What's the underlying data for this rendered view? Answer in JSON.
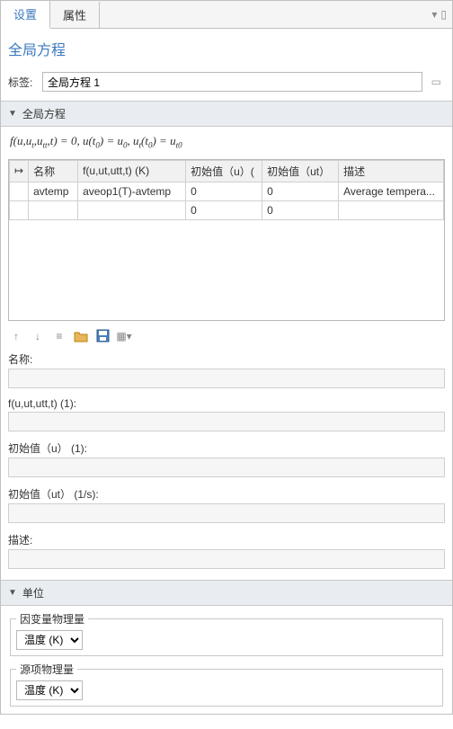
{
  "tabs": {
    "settings": "设置",
    "properties": "属性"
  },
  "title": "全局方程",
  "tag_label": "标签:",
  "tag_value": "全局方程 1",
  "section_global": "全局方程",
  "formula_html": "f(u,u<span class='sub'>t</span>,u<span class='sub'>tt</span>,t) = 0,  u(t<span class='sub'>0</span>) = u<span class='sub'>0</span>,  u<span class='sub'>t</span>(t<span class='sub'>0</span>) = u<span class='sub'>t0</span>",
  "table": {
    "headers": {
      "arrow": "↦",
      "name": "名称",
      "f": "f(u,ut,utt,t) (K)",
      "u0": "初始值（u）(",
      "ut0": "初始值（ut）",
      "desc": "描述"
    },
    "rows": [
      {
        "name": "avtemp",
        "f": "aveop1(T)-avtemp",
        "u0": "0",
        "ut0": "0",
        "desc": "Average tempera..."
      },
      {
        "name": "",
        "f": "",
        "u0": "0",
        "ut0": "0",
        "desc": ""
      }
    ]
  },
  "fields": {
    "name_label": "名称:",
    "f_label": "f(u,ut,utt,t) (1):",
    "u0_label": "初始值（u） (1):",
    "ut0_label": "初始值（ut） (1/s):",
    "desc_label": "描述:"
  },
  "section_units": "单位",
  "units": {
    "depvar_legend": "因变量物理量",
    "depvar_value": "温度 (K)",
    "source_legend": "源项物理量",
    "source_value": "温度 (K)"
  }
}
